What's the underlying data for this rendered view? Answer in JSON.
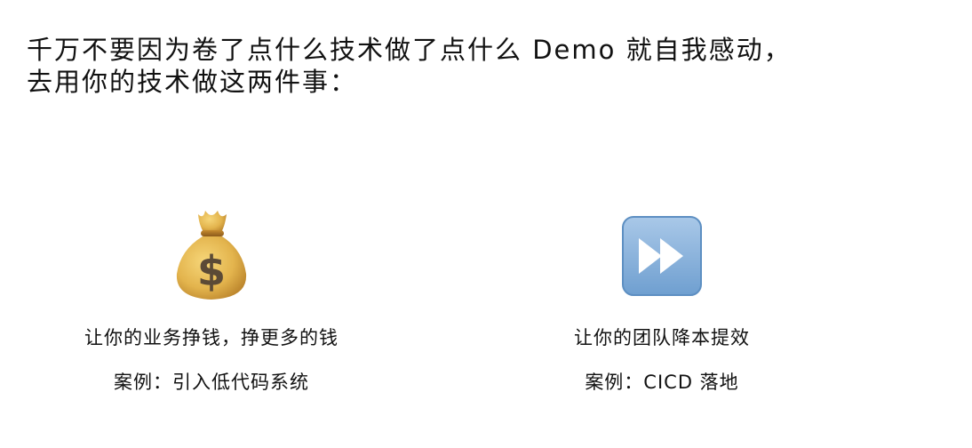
{
  "headline": {
    "line1": "千万不要因为卷了点什么技术做了点什么 Demo 就自我感动，",
    "line2": "去用你的技术做这两件事："
  },
  "items": [
    {
      "icon": "money-bag-icon",
      "description": "让你的业务挣钱，挣更多的钱",
      "example": "案例：引入低代码系统"
    },
    {
      "icon": "fast-forward-icon",
      "description": "让你的团队降本提效",
      "example": "案例：CICD 落地"
    }
  ],
  "colors": {
    "text": "#111111",
    "bag": "#e3b44d",
    "bag_dark": "#b9822a",
    "dollar": "#5b4a36",
    "button": "#8db6df",
    "button_edge": "#5d8fc2",
    "arrow": "#ffffff"
  }
}
